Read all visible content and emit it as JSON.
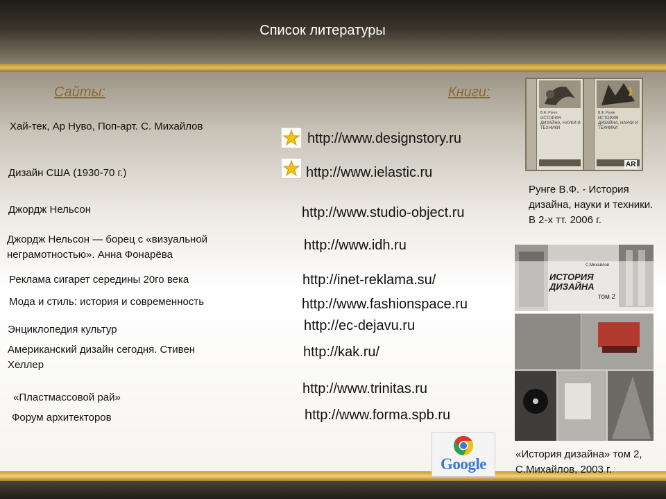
{
  "slide": {
    "title": "Список литературы"
  },
  "headings": {
    "sites": "Сайты:",
    "books": "Книги:"
  },
  "sites": [
    "Хай-тек, Ар Нуво, Поп-арт. С. Михайлов",
    "Дизайн США (1930-70 г.)",
    "Джордж Нельсон",
    "Джордж Нельсон — борец с «визуальной неграмотностью». Анна Фонарёва",
    "Реклама сигарет середины 20го века",
    "Мода и стиль: история и современность",
    "Энциклопедия культур",
    "Американский дизайн сегодня. Стивен Хеллер",
    "«Пластмассовой рай»",
    "Форум архитекторов"
  ],
  "links": [
    "http://www.designstory.ru",
    "http://www.ielastic.ru",
    "http://www.studio-object.ru",
    "http://www.idh.ru",
    "http://inet-reklama.su/",
    "http://www.fashionspace.ru",
    "http://ec-dejavu.ru",
    "http://kak.ru/",
    "http://www.trinitas.ru",
    "http://www.forma.spb.ru"
  ],
  "books": [
    {
      "caption": "Рунге В.Ф. - История дизайна, науки и техники. В 2-х тт. 2006 г.",
      "cover_title": "ИСТОРИЯ ДИЗАЙНА, НАУКИ И ТЕХНИКИ",
      "cover_author": "В.Ф. Рунге",
      "publisher_mark": "AR"
    },
    {
      "caption": "«История дизайна» том 2, С.Михайлов, 2003 г.",
      "cover_author": "С.Михайлов",
      "cover_title": "ИСТОРИЯ ДИЗАЙНА",
      "cover_volume": "том 2"
    }
  ],
  "logo": {
    "text": "Google"
  },
  "icons": {
    "link_marker": "star-icon",
    "browser": "chrome-icon"
  },
  "colors": {
    "heading": "#8b6b2e",
    "gold": "#d9b550",
    "star": "#f2c40f"
  }
}
